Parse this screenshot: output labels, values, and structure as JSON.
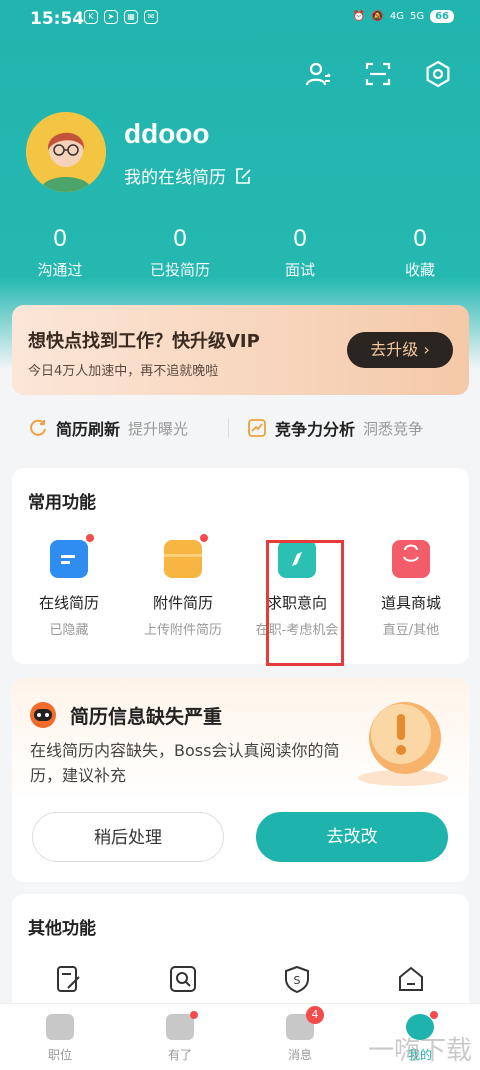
{
  "status_bar": {
    "time": "15:54",
    "battery": "66",
    "net1": "4G",
    "net2": "5G"
  },
  "profile": {
    "username": "ddooo",
    "resume_link": "我的在线简历"
  },
  "stats": [
    {
      "value": "0",
      "label": "沟通过"
    },
    {
      "value": "0",
      "label": "已投简历"
    },
    {
      "value": "0",
      "label": "面试"
    },
    {
      "value": "0",
      "label": "收藏"
    }
  ],
  "vip": {
    "title": "想快点找到工作？快升级VIP",
    "subtitle": "今日4万人加速中，再不追就晚啦",
    "button": "去升级 ›"
  },
  "quick": [
    {
      "title": "简历刷新",
      "sub": "提升曝光"
    },
    {
      "title": "竞争力分析",
      "sub": "洞悉竞争"
    }
  ],
  "common": {
    "title": "常用功能",
    "items": [
      {
        "name": "在线简历",
        "sub": "已隐藏",
        "color": "#2f8cf0"
      },
      {
        "name": "附件简历",
        "sub": "上传附件简历",
        "color": "#f7b642"
      },
      {
        "name": "求职意向",
        "sub": "在职-考虑机会",
        "color": "#2cc0b4"
      },
      {
        "name": "道具商城",
        "sub": "直豆/其他",
        "color": "#f35d6a"
      }
    ]
  },
  "warning": {
    "title": "简历信息缺失严重",
    "desc": "在线简历内容缺失，Boss会认真阅读你的简历，建议补充",
    "later": "稍后处理",
    "fix": "去改改"
  },
  "other": {
    "title": "其他功能"
  },
  "tabs": [
    {
      "label": "职位"
    },
    {
      "label": "有了"
    },
    {
      "label": "消息",
      "badge": "4"
    },
    {
      "label": "我的"
    }
  ],
  "watermark": "一嗨下载"
}
